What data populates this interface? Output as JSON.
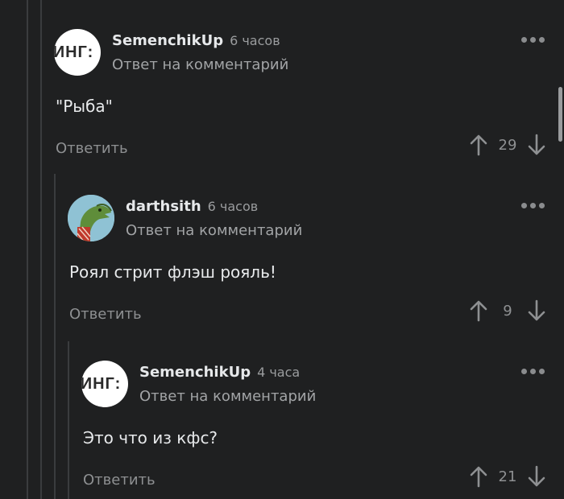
{
  "comments": [
    {
      "avatar_text": "ИНГ:",
      "username": "SemenchikUp",
      "time": "6 часов",
      "reply_to": "Ответ на комментарий",
      "text": "\"Рыба\"",
      "reply_label": "Ответить",
      "score": "29"
    },
    {
      "username": "darthsith",
      "time": "6 часов",
      "reply_to": "Ответ на комментарий",
      "text": "Роял стрит флэш рояль!",
      "reply_label": "Ответить",
      "score": "9"
    },
    {
      "avatar_text": "ИНГ:",
      "username": "SemenchikUp",
      "time": "4 часа",
      "reply_to": "Ответ на комментарий",
      "text": "Это что из кфс?",
      "reply_label": "Ответить",
      "score": "21"
    }
  ],
  "icons": {
    "menu": "more-dots-icon",
    "upvote": "arrow-up-icon",
    "downvote": "arrow-down-icon"
  },
  "colors": {
    "background": "#1f2021",
    "thread_line": "#3a3c3e",
    "muted_text": "#8e9092"
  }
}
